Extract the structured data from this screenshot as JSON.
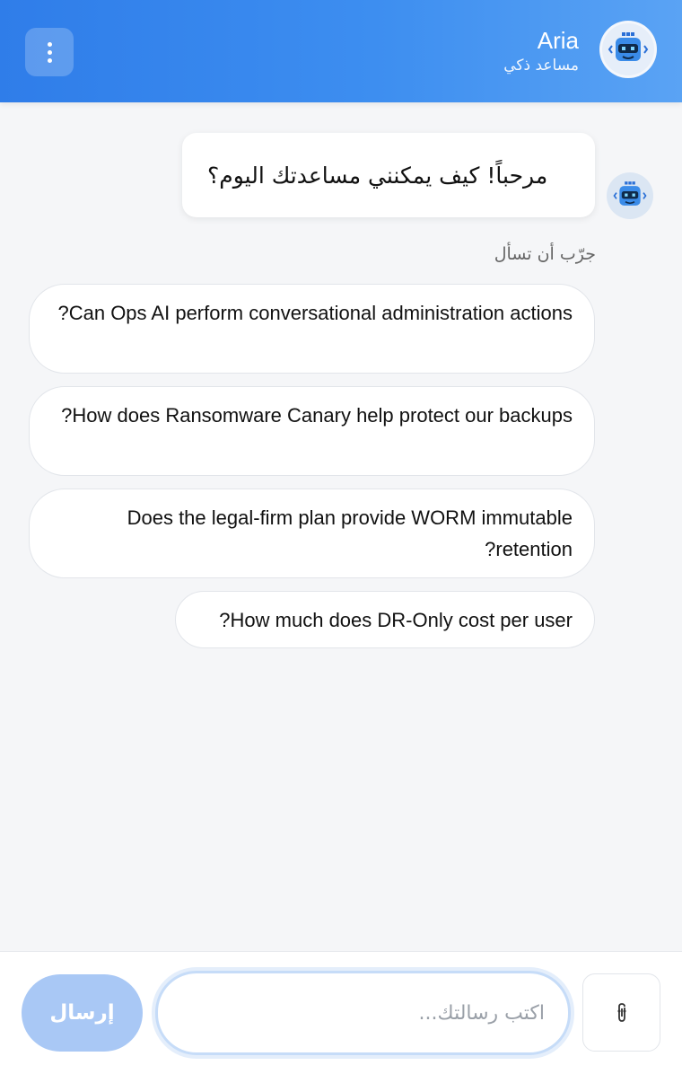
{
  "header": {
    "name": "Aria",
    "subtitle": "مساعد ذكي",
    "menu_icon": "more-vertical-icon",
    "avatar_icon": "robot-icon",
    "colors": {
      "start": "#2f7de9",
      "end": "#5aa3f4"
    }
  },
  "chat": {
    "greeting": "مرحباً! كيف يمكنني مساعدتك اليوم؟",
    "try_label": "جرّب أن تسأل",
    "suggestions": [
      "Can Ops AI perform conversational administration actions?",
      "How does Ransomware Canary help protect our backups?",
      "Does the legal-firm plan provide WORM immutable retention?",
      "How much does DR-Only cost per user?"
    ]
  },
  "composer": {
    "placeholder": "اكتب رسالتك...",
    "send_label": "إرسال",
    "attach_icon": "paperclip-icon",
    "send_color": "#a9c8f5"
  }
}
